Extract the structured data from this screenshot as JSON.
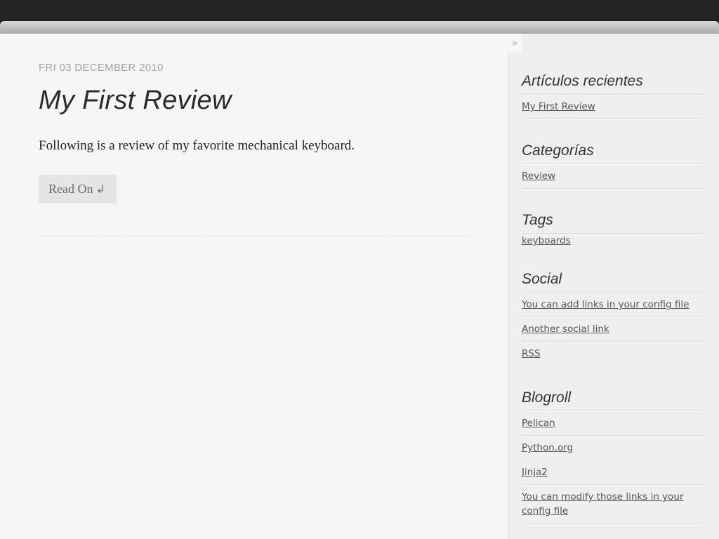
{
  "nav": {
    "collapse_icon": "»"
  },
  "post": {
    "date": "FRI 03 DECEMBER 2010",
    "title": "My First Review",
    "summary": "Following is a review of my favorite mechanical keyboard.",
    "read_on_label": "Read On",
    "read_on_icon": "↲"
  },
  "sidebar": {
    "recent": {
      "title": "Artículos recientes",
      "items": [
        "My First Review"
      ]
    },
    "categories": {
      "title": "Categorías",
      "items": [
        "Review"
      ]
    },
    "tags": {
      "title": "Tags",
      "items": [
        "keyboards"
      ]
    },
    "social": {
      "title": "Social",
      "items": [
        "You can add links in your config file",
        "Another social link",
        "RSS"
      ]
    },
    "blogroll": {
      "title": "Blogroll",
      "items": [
        "Pelican",
        "Python.org",
        "Jinja2",
        "You can modify those links in your config file"
      ]
    }
  }
}
